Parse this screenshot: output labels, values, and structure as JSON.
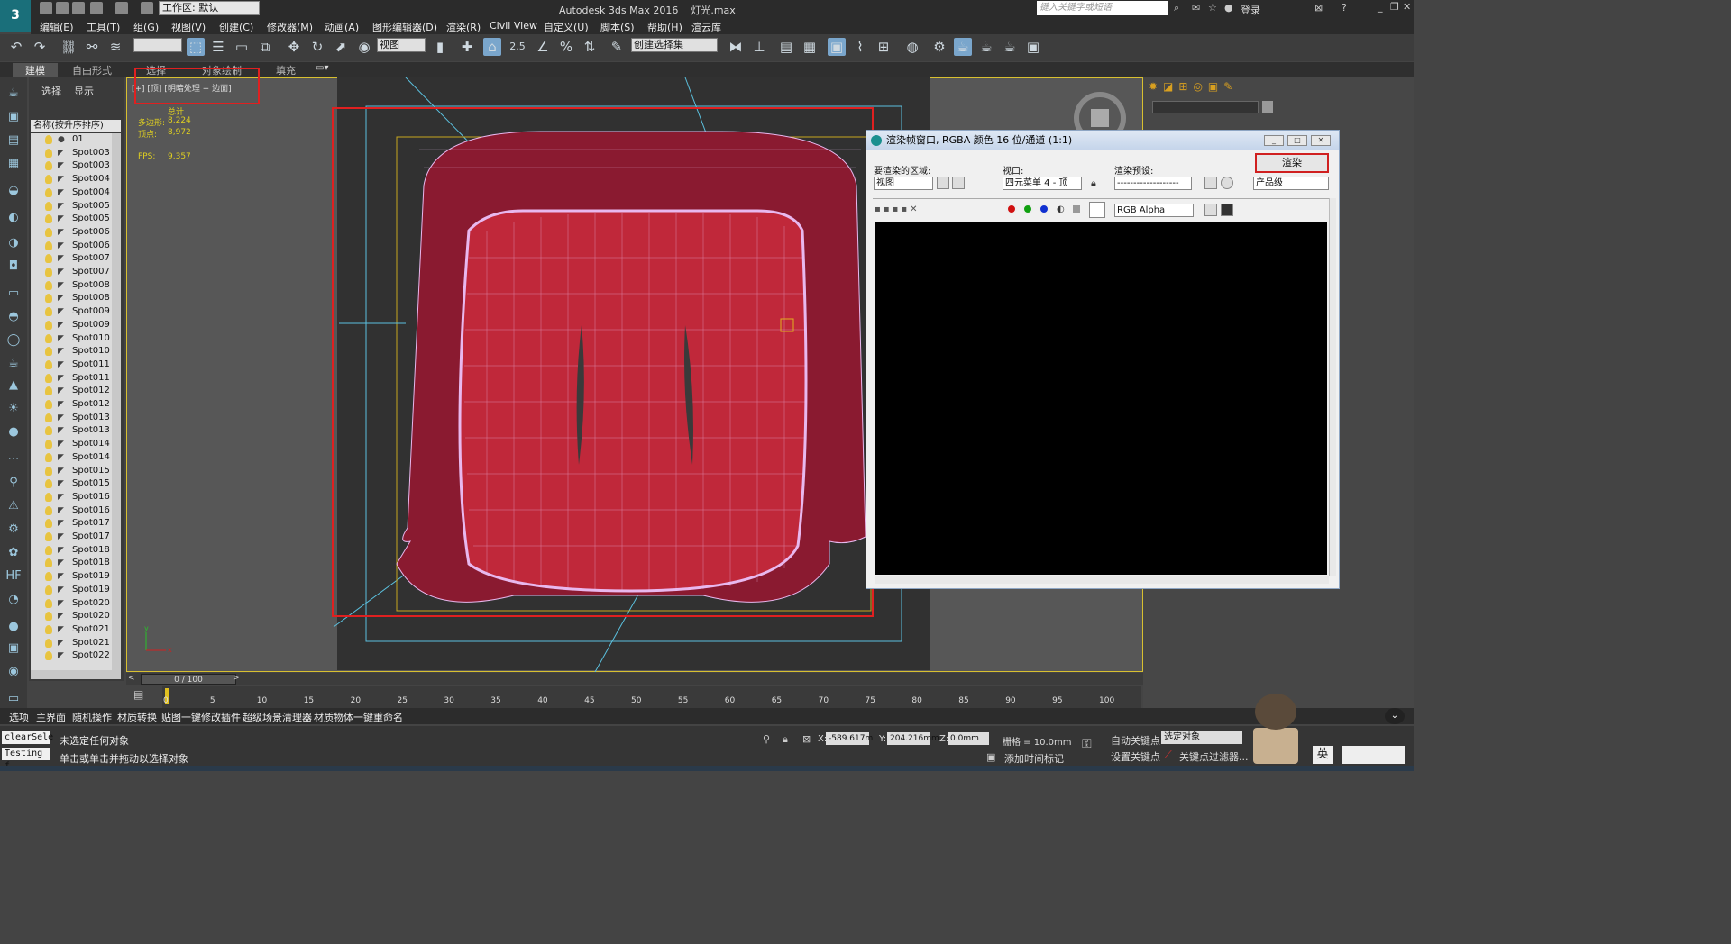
{
  "title": {
    "app": "Autodesk 3ds Max 2016",
    "file": "灯光.max",
    "workspace": "工作区: 默认",
    "search_placeholder": "键入关键字或短语",
    "login": "登录"
  },
  "menu": [
    "编辑(E)",
    "工具(T)",
    "组(G)",
    "视图(V)",
    "创建(C)",
    "修改器(M)",
    "动画(A)",
    "图形编辑器(D)",
    "渲染(R)",
    "Civil View",
    "自定义(U)",
    "脚本(S)",
    "帮助(H)",
    "渲云库"
  ],
  "toolbar": {
    "view_combo": "视图",
    "selection_set": "创建选择集",
    "snap_value": "2.5"
  },
  "ribbon_tabs": [
    "建模",
    "自由形式",
    "选择",
    "对象绘制",
    "填充"
  ],
  "explorer": {
    "tabs": [
      "选择",
      "显示"
    ],
    "header": "名称(按升序排序)",
    "items": [
      "01",
      "Spot003",
      "Spot003",
      "Spot004",
      "Spot004",
      "Spot005",
      "Spot005",
      "Spot006",
      "Spot006",
      "Spot007",
      "Spot007",
      "Spot008",
      "Spot008",
      "Spot009",
      "Spot009",
      "Spot010",
      "Spot010",
      "Spot011",
      "Spot011",
      "Spot012",
      "Spot012",
      "Spot013",
      "Spot013",
      "Spot014",
      "Spot014",
      "Spot015",
      "Spot015",
      "Spot016",
      "Spot016",
      "Spot017",
      "Spot017",
      "Spot018",
      "Spot018",
      "Spot019",
      "Spot019",
      "Spot020",
      "Spot020",
      "Spot021",
      "Spot021",
      "Spot022"
    ]
  },
  "viewport": {
    "label": "[+] [顶] [明暗处理 + 边面]",
    "total_label": "总计",
    "polys_label": "多边形:",
    "polys": "8,224",
    "verts_label": "顶点:",
    "verts": "8,972",
    "fps_label": "FPS:",
    "fps": "9.357"
  },
  "render_window": {
    "title": "渲染帧窗口, RGBA 颜色 16 位/通道 (1:1)",
    "area_label": "要渲染的区域:",
    "area_value": "视图",
    "viewport_label": "视口:",
    "viewport_value": "四元菜单 4 - 顶",
    "preset_label": "渲染预设:",
    "preset_value": "-------------------",
    "render_button": "渲染",
    "quality_value": "产品级",
    "channel_value": "RGB Alpha"
  },
  "timeline": {
    "frame": "0 / 100",
    "ticks": [
      "0",
      "5",
      "10",
      "15",
      "20",
      "25",
      "30",
      "35",
      "40",
      "45",
      "50",
      "55",
      "60",
      "65",
      "70",
      "75",
      "80",
      "85",
      "90",
      "95",
      "100"
    ]
  },
  "quickbar": [
    "选项",
    "主界面",
    "随机操作",
    "材质转换",
    "贴图一键修改插件",
    "超级场景清理器",
    "材质物体一键重命名"
  ],
  "status": {
    "left1": "clearSele",
    "left2": "Testing f",
    "msg1": "未选定任何对象",
    "msg2": "单击或单击并拖动以选择对象",
    "x_label": "X:",
    "x": "-589.617m",
    "y_label": "Y:",
    "y": "204.216mm",
    "z_label": "Z:",
    "z": "0.0mm",
    "grid": "栅格 = 10.0mm",
    "auto_key": "自动关键点",
    "set_key": "设置关键点",
    "selected": "选定对象",
    "filter": "关键点过滤器...",
    "add_time_tag": "添加时间标记",
    "ime": "英"
  },
  "colors": {
    "mesh": "#c0283a",
    "wire": "#e8b8ee",
    "red_box": "#e02020",
    "accent": "#7aa6cc"
  }
}
